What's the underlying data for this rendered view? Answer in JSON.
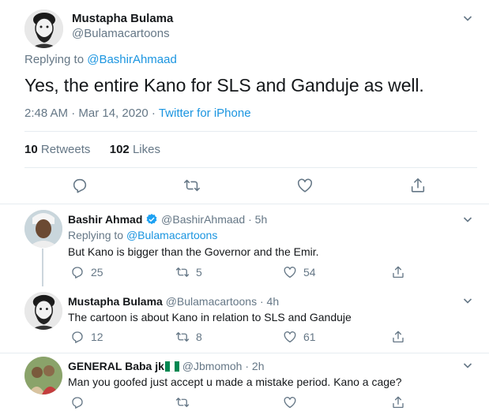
{
  "main_tweet": {
    "name": "Mustapha Bulama",
    "handle": "@Bulamacartoons",
    "replying_prefix": "Replying to",
    "replying_to": "@BashirAhmaad",
    "text": "Yes, the entire Kano for SLS and Ganduje as well.",
    "time": "2:48 AM · Mar 14, 2020 · ",
    "source": "Twitter for iPhone",
    "retweets_count": "10",
    "retweets_label": "Retweets",
    "likes_count": "102",
    "likes_label": "Likes"
  },
  "replies": [
    {
      "name": "Bashir Ahmad",
      "verified": true,
      "handle": "@BashirAhmaad",
      "time": "· 5h",
      "replying_prefix": "Replying to",
      "replying_to": "@Bulamacartoons",
      "text": "But Kano is bigger than the Governor and the Emir.",
      "replies": "25",
      "retweets": "5",
      "likes": "54"
    },
    {
      "name": "Mustapha Bulama",
      "handle": "@Bulamacartoons",
      "time": "· 4h",
      "text": "The cartoon is about Kano in relation to SLS and Ganduje",
      "replies": "12",
      "retweets": "8",
      "likes": "61"
    },
    {
      "name": "GENERAL Baba jk",
      "flag": "nigeria-flag",
      "handle": "@Jbmomoh",
      "time": "· 2h",
      "text": "Man you goofed just accept u made a mistake period. Kano a cage?"
    }
  ],
  "colors": {
    "link": "#1b95e0",
    "muted": "#657786",
    "divider": "#e6ecf0",
    "verified": "#1da1f2"
  }
}
